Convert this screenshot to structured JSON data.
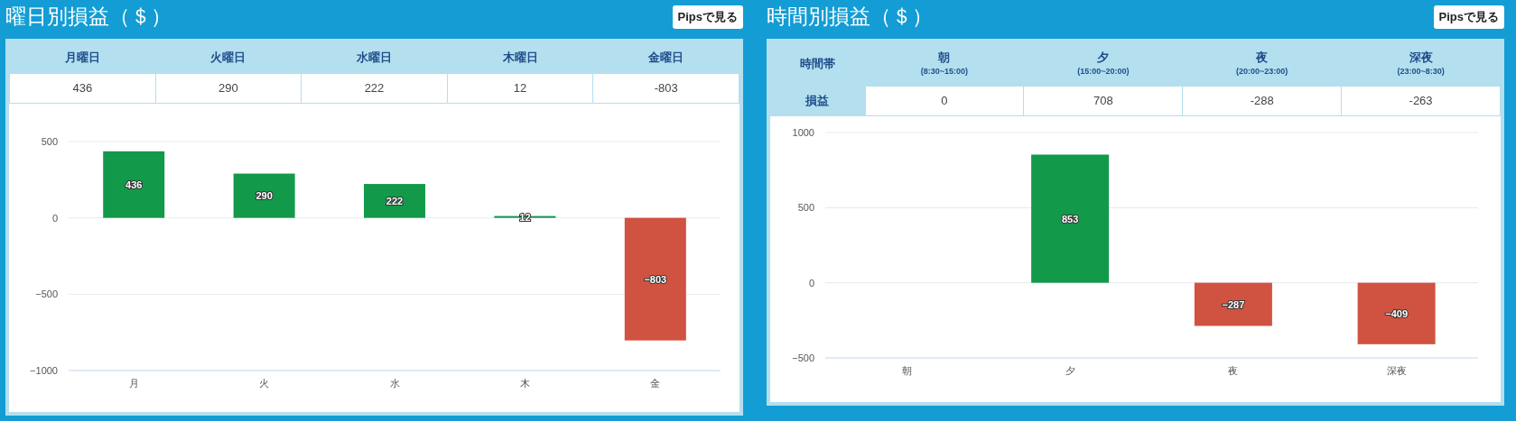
{
  "panels": [
    {
      "title": "曜日別損益（＄）",
      "button": "Pipsで見る",
      "table": {
        "columns": [
          {
            "label": "月曜日"
          },
          {
            "label": "火曜日"
          },
          {
            "label": "水曜日"
          },
          {
            "label": "木曜日"
          },
          {
            "label": "金曜日"
          }
        ],
        "values": [
          "436",
          "290",
          "222",
          "12",
          "-803"
        ]
      },
      "chart_data": {
        "type": "bar",
        "categories": [
          "月",
          "火",
          "水",
          "木",
          "金"
        ],
        "stacked": true,
        "series": [
          {
            "color": "#12994a",
            "values": [
              436,
              290,
              222,
              12,
              null
            ]
          },
          {
            "color": "#d05240",
            "values": [
              null,
              null,
              null,
              null,
              -803
            ]
          }
        ],
        "ylim": [
          -1000,
          500
        ],
        "yticks": [
          {
            "value": 500,
            "label": "500"
          },
          {
            "value": 0,
            "label": "0"
          },
          {
            "value": -500,
            "label": "−500"
          },
          {
            "value": -1000,
            "label": "−1000"
          }
        ],
        "value_labels": [
          "436",
          "290",
          "222",
          "12",
          "−803"
        ]
      }
    },
    {
      "title": "時間別損益（＄）",
      "button": "Pipsで見る",
      "table": {
        "corner": "時間帯",
        "row_label": "損益",
        "columns": [
          {
            "label": "朝",
            "sub": "(8:30~15:00)"
          },
          {
            "label": "夕",
            "sub": "(15:00~20:00)"
          },
          {
            "label": "夜",
            "sub": "(20:00~23:00)"
          },
          {
            "label": "深夜",
            "sub": "(23:00~8:30)"
          }
        ],
        "values": [
          "0",
          "708",
          "-288",
          "-263"
        ]
      },
      "chart_data": {
        "type": "bar",
        "categories": [
          "朝",
          "夕",
          "夜",
          "深夜"
        ],
        "stacked": true,
        "series": [
          {
            "color": "#12994a",
            "values": [
              null,
              853,
              null,
              null
            ]
          },
          {
            "color": "#d05240",
            "values": [
              null,
              null,
              -287,
              -409
            ]
          }
        ],
        "ylim": [
          -500,
          1000
        ],
        "yticks": [
          {
            "value": 1000,
            "label": "1000"
          },
          {
            "value": 500,
            "label": "500"
          },
          {
            "value": 0,
            "label": "0"
          },
          {
            "value": -500,
            "label": "−500"
          }
        ],
        "value_labels": [
          null,
          "853",
          "−287",
          "−409"
        ]
      }
    }
  ]
}
